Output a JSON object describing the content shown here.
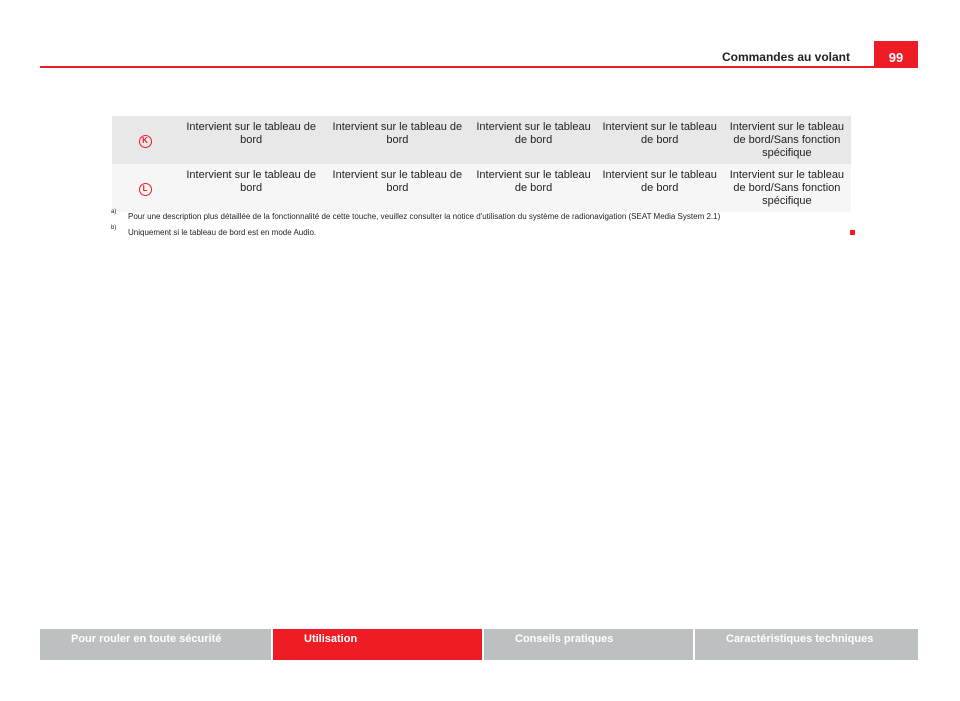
{
  "header": {
    "title": "Commandes au volant",
    "page_number": "99"
  },
  "table": {
    "rows": [
      {
        "key": "K",
        "cells": [
          "Intervient sur le tableau de bord",
          "Intervient sur le tableau de bord",
          "Intervient sur le tableau de bord",
          "Intervient sur le tableau de bord",
          "Intervient sur le tableau de bord/Sans fonction spécifique"
        ]
      },
      {
        "key": "L",
        "cells": [
          "Intervient sur le tableau de bord",
          "Intervient sur le tableau de bord",
          "Intervient sur le tableau de bord",
          "Intervient sur le tableau de bord",
          "Intervient sur le tableau de bord/Sans fonction spécifique"
        ]
      }
    ]
  },
  "footnotes": [
    {
      "marker": "a)",
      "text": "Pour une description plus détaillée de la fonctionnalité de cette touche, veuillez consulter la notice d'utilisation du système de radionavigation (SEAT Media System 2.1)"
    },
    {
      "marker": "b)",
      "text": "Uniquement si le tableau de bord est en mode Audio."
    }
  ],
  "footer": {
    "tabs": [
      {
        "label": "Pour rouler en toute sécurité"
      },
      {
        "label": "Utilisation"
      },
      {
        "label": "Conseils pratiques"
      },
      {
        "label": "Caractéristiques techniques"
      }
    ]
  },
  "colors": {
    "accent": "#ee1c25",
    "footer_gray": "#bcc0c0"
  }
}
